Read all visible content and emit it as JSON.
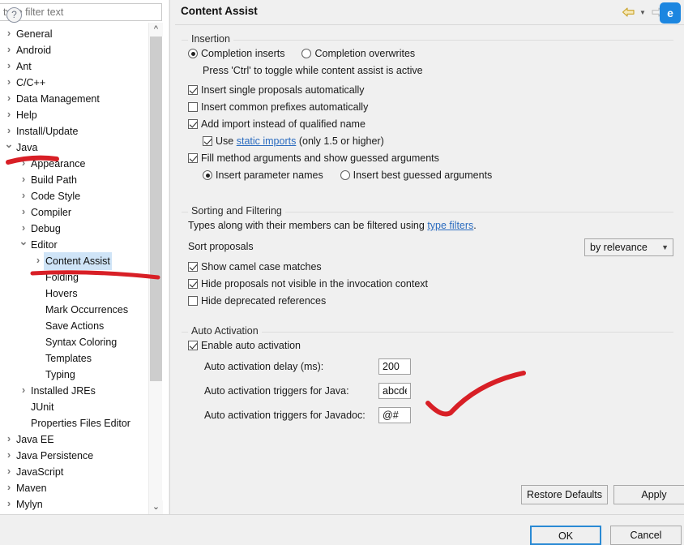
{
  "window": {
    "title": "Content Assist"
  },
  "sidebar": {
    "filter": {
      "placeholder": "type filter text",
      "value": ""
    },
    "items": [
      {
        "label": "General",
        "depth": 0,
        "twisty": "collapsed",
        "selected": false
      },
      {
        "label": "Android",
        "depth": 0,
        "twisty": "collapsed",
        "selected": false
      },
      {
        "label": "Ant",
        "depth": 0,
        "twisty": "collapsed",
        "selected": false
      },
      {
        "label": "C/C++",
        "depth": 0,
        "twisty": "collapsed",
        "selected": false
      },
      {
        "label": "Data Management",
        "depth": 0,
        "twisty": "collapsed",
        "selected": false
      },
      {
        "label": "Help",
        "depth": 0,
        "twisty": "collapsed",
        "selected": false
      },
      {
        "label": "Install/Update",
        "depth": 0,
        "twisty": "collapsed",
        "selected": false
      },
      {
        "label": "Java",
        "depth": 0,
        "twisty": "expanded",
        "selected": false
      },
      {
        "label": "Appearance",
        "depth": 1,
        "twisty": "collapsed",
        "selected": false
      },
      {
        "label": "Build Path",
        "depth": 1,
        "twisty": "collapsed",
        "selected": false
      },
      {
        "label": "Code Style",
        "depth": 1,
        "twisty": "collapsed",
        "selected": false
      },
      {
        "label": "Compiler",
        "depth": 1,
        "twisty": "collapsed",
        "selected": false
      },
      {
        "label": "Debug",
        "depth": 1,
        "twisty": "collapsed",
        "selected": false
      },
      {
        "label": "Editor",
        "depth": 1,
        "twisty": "expanded",
        "selected": false
      },
      {
        "label": "Content Assist",
        "depth": 2,
        "twisty": "collapsed",
        "selected": true
      },
      {
        "label": "Folding",
        "depth": 2,
        "twisty": "none",
        "selected": false
      },
      {
        "label": "Hovers",
        "depth": 2,
        "twisty": "none",
        "selected": false
      },
      {
        "label": "Mark Occurrences",
        "depth": 2,
        "twisty": "none",
        "selected": false
      },
      {
        "label": "Save Actions",
        "depth": 2,
        "twisty": "none",
        "selected": false
      },
      {
        "label": "Syntax Coloring",
        "depth": 2,
        "twisty": "none",
        "selected": false
      },
      {
        "label": "Templates",
        "depth": 2,
        "twisty": "none",
        "selected": false
      },
      {
        "label": "Typing",
        "depth": 2,
        "twisty": "none",
        "selected": false
      },
      {
        "label": "Installed JREs",
        "depth": 1,
        "twisty": "collapsed",
        "selected": false
      },
      {
        "label": "JUnit",
        "depth": 1,
        "twisty": "none",
        "selected": false
      },
      {
        "label": "Properties Files Editor",
        "depth": 1,
        "twisty": "none",
        "selected": false
      },
      {
        "label": "Java EE",
        "depth": 0,
        "twisty": "collapsed",
        "selected": false
      },
      {
        "label": "Java Persistence",
        "depth": 0,
        "twisty": "collapsed",
        "selected": false
      },
      {
        "label": "JavaScript",
        "depth": 0,
        "twisty": "collapsed",
        "selected": false
      },
      {
        "label": "Maven",
        "depth": 0,
        "twisty": "collapsed",
        "selected": false
      },
      {
        "label": "Mylyn",
        "depth": 0,
        "twisty": "collapsed",
        "selected": false
      }
    ]
  },
  "nav": {
    "back_icon": "back-arrow-icon",
    "forward_icon": "forward-arrow-icon",
    "badge_glyph": "e"
  },
  "insertion": {
    "group_title": "Insertion",
    "radio_inserts": "Completion inserts",
    "radio_overwrites": "Completion overwrites",
    "hint": "Press 'Ctrl' to toggle while content assist is active",
    "cb_single_proposals": "Insert single proposals automatically",
    "cb_common_prefixes": "Insert common prefixes automatically",
    "cb_add_import": "Add import instead of qualified name",
    "static_use": "Use",
    "static_link": "static imports",
    "static_tail": "(only 1.5 or higher)",
    "cb_fill_method": "Fill method arguments and show guessed arguments",
    "radio_param_names": "Insert parameter names",
    "radio_best_guessed": "Insert best guessed arguments"
  },
  "sorting": {
    "group_title": "Sorting and Filtering",
    "desc_pre": "Types along with their members can be filtered using",
    "desc_link": "type filters",
    "desc_post": ".",
    "sort_label": "Sort proposals",
    "sort_value": "by relevance",
    "cb_camel_case": "Show camel case matches",
    "cb_hide_not_visible": "Hide proposals not visible in the invocation context",
    "cb_hide_deprecated": "Hide deprecated references"
  },
  "auto_activation": {
    "group_title": "Auto Activation",
    "cb_enable": "Enable auto activation",
    "delay_label": "Auto activation delay (ms):",
    "delay_value": "200",
    "java_label": "Auto activation triggers for Java:",
    "java_value": "abcde",
    "javadoc_label": "Auto activation triggers for Javadoc:",
    "javadoc_value": "@#"
  },
  "buttons": {
    "restore_defaults": "Restore Defaults",
    "apply": "Apply",
    "ok": "OK",
    "cancel": "Cancel",
    "help_icon": "?"
  },
  "colors": {
    "selection": "#cfe4f7",
    "link": "#2a6bbf",
    "annotation": "#d81f26",
    "focus": "#2a8ad4",
    "badge": "#1c86e0"
  }
}
